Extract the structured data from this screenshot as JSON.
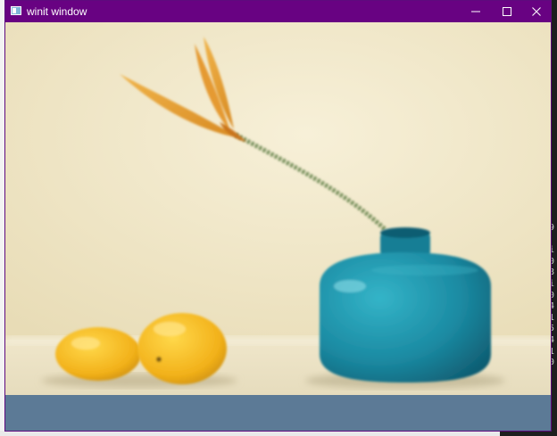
{
  "window": {
    "title": "winit window",
    "controls": {
      "minimize_icon": "minimize-icon",
      "maximize_icon": "maximize-icon",
      "close_icon": "close-icon"
    },
    "app_icon": "app-window-icon"
  },
  "content": {
    "scene": "photo-still-life",
    "colors": {
      "wall": "#f1e8c9",
      "table": "#ece3c6",
      "vase": "#1e90a8",
      "lemon": "#f2b51e",
      "bird_of_paradise": "#e8a233",
      "stem": "#6f8a54",
      "below_area": "#5c7a96"
    }
  },
  "background": {
    "terminal_digits": "9\n\ni\n0\n8\ni\n0\n4\n1\n5\n4\n1\n0"
  }
}
